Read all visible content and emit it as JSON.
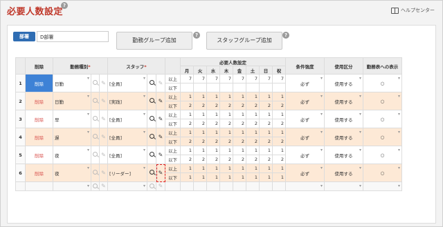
{
  "header": {
    "title": "必要人数設定",
    "help_label": "ヘルプセンター"
  },
  "toolbar": {
    "dept_label": "部署",
    "dept_value": "D部署",
    "add_shift_group": "勤務グループ追加",
    "add_staff_group": "スタッフグループ追加"
  },
  "table": {
    "headers": {
      "delete": "削除",
      "shift_type": "勤務種別",
      "staff": "スタッフ",
      "required": "必要人数設定",
      "condition": "条件強度",
      "usage": "使用区分",
      "display": "勤務表への表示"
    },
    "days": [
      "月",
      "火",
      "水",
      "木",
      "金",
      "土",
      "日",
      "祝"
    ],
    "rows": [
      {
        "no": "1",
        "del": "削除",
        "shift": "日勤",
        "staff": "[全員]",
        "above": [
          "7",
          "7",
          "7",
          "7",
          "7",
          "7",
          "7",
          "7"
        ],
        "below": [
          "",
          "",
          "",
          "",
          "",
          "",
          "",
          ""
        ],
        "cond": "必ず",
        "usage": "使用する",
        "disp": "○",
        "above_label": "以上",
        "below_label": "以下"
      },
      {
        "no": "2",
        "del": "削除",
        "shift": "日勤",
        "staff": "[実践]",
        "above": [
          "1",
          "1",
          "1",
          "1",
          "1",
          "1",
          "1",
          "1"
        ],
        "below": [
          "2",
          "2",
          "2",
          "2",
          "2",
          "2",
          "2",
          "2"
        ],
        "cond": "必ず",
        "usage": "使用する",
        "disp": "○",
        "above_label": "以上",
        "below_label": "以下"
      },
      {
        "no": "3",
        "del": "削除",
        "shift": "早",
        "staff": "[全員]",
        "above": [
          "1",
          "1",
          "1",
          "1",
          "1",
          "1",
          "1",
          "1"
        ],
        "below": [
          "2",
          "2",
          "2",
          "2",
          "2",
          "2",
          "2",
          "2"
        ],
        "cond": "必ず",
        "usage": "使用する",
        "disp": "○",
        "above_label": "以上",
        "below_label": "以下"
      },
      {
        "no": "4",
        "del": "削除",
        "shift": "遅",
        "staff": "[全員]",
        "above": [
          "1",
          "1",
          "1",
          "1",
          "1",
          "1",
          "1",
          "1"
        ],
        "below": [
          "2",
          "2",
          "2",
          "2",
          "2",
          "2",
          "2",
          "2"
        ],
        "cond": "必ず",
        "usage": "使用する",
        "disp": "○",
        "above_label": "以上",
        "below_label": "以下"
      },
      {
        "no": "5",
        "del": "削除",
        "shift": "夜",
        "staff": "[全員]",
        "above": [
          "1",
          "1",
          "1",
          "1",
          "1",
          "1",
          "1",
          "1"
        ],
        "below": [
          "2",
          "2",
          "2",
          "2",
          "2",
          "2",
          "2",
          "2"
        ],
        "cond": "必ず",
        "usage": "使用する",
        "disp": "○",
        "above_label": "以上",
        "below_label": "以下"
      },
      {
        "no": "6",
        "del": "削除",
        "shift": "夜",
        "staff": "[リーダー]",
        "above": [
          "1",
          "1",
          "1",
          "1",
          "1",
          "1",
          "1",
          "1"
        ],
        "below": [
          "1",
          "1",
          "1",
          "1",
          "1",
          "1",
          "1",
          "1"
        ],
        "cond": "必ず",
        "usage": "使用する",
        "disp": "○",
        "above_label": "以上",
        "below_label": "以下"
      }
    ]
  }
}
